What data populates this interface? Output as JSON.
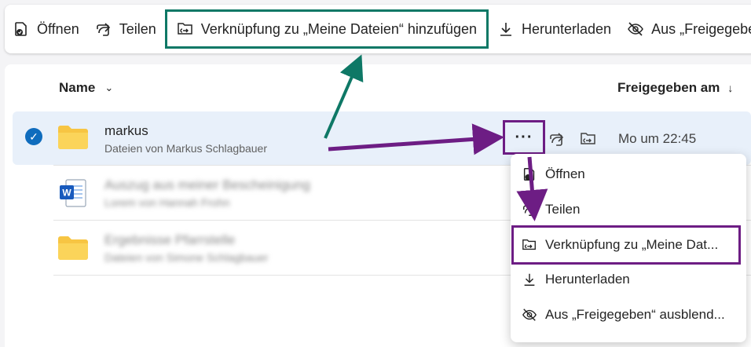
{
  "toolbar": {
    "open_label": "Öffnen",
    "share_label": "Teilen",
    "add_shortcut_label": "Verknüpfung zu „Meine Dateien“ hinzufügen",
    "download_label": "Herunterladen",
    "hide_label": "Aus „Freigegebe"
  },
  "list": {
    "col_name": "Name",
    "col_date": "Freigegeben am",
    "rows": [
      {
        "title": "markus",
        "subtitle": "Dateien von Markus Schlagbauer",
        "date": "Mo um 22:45",
        "icon": "folder-icon",
        "selected": true
      },
      {
        "title": "Auszug aus meiner Bescheinigung",
        "subtitle": "Lorem von Hannah Frohn",
        "icon": "word-doc-icon",
        "selected": false
      },
      {
        "title": "Ergebnisse Pfarrstelle",
        "subtitle": "Dateien von Simone Schlagbauer",
        "icon": "folder-icon",
        "selected": false
      }
    ]
  },
  "context_menu": {
    "items": [
      {
        "label": "Öffnen",
        "icon": "open-icon"
      },
      {
        "label": "Teilen",
        "icon": "share-icon"
      },
      {
        "label": "Verknüpfung zu „Meine Dat...",
        "icon": "add-shortcut-icon"
      },
      {
        "label": "Herunterladen",
        "icon": "download-icon"
      },
      {
        "label": "Aus „Freigegeben“ ausblend...",
        "icon": "hide-icon"
      }
    ]
  },
  "more_button": {
    "label": "···"
  },
  "colors": {
    "accent": "#0f6cbd",
    "teal_annotation": "#0e7866",
    "purple_annotation": "#6d1d84",
    "folder": "#f7c543"
  }
}
